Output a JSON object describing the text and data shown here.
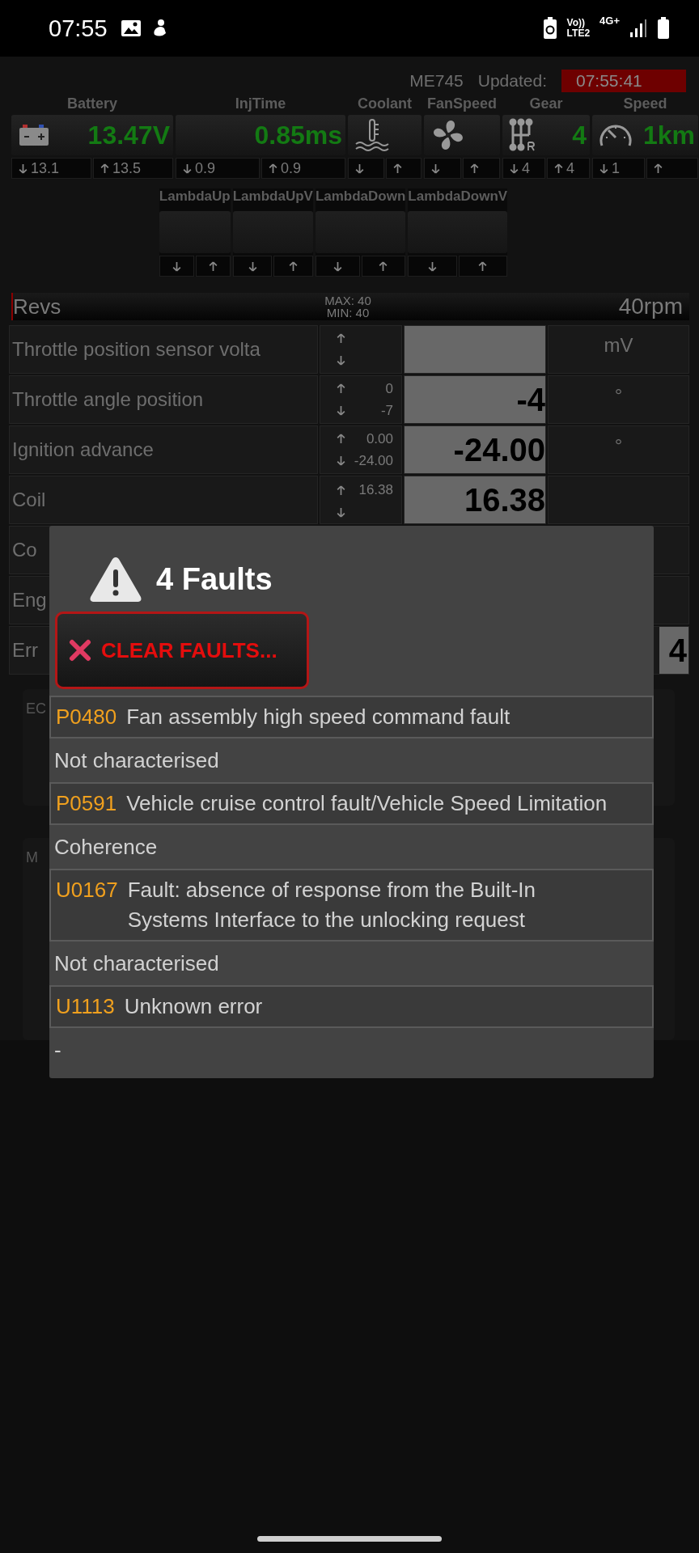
{
  "status_bar": {
    "time": "07:55",
    "volte": "Vo))",
    "lte": "LTE2",
    "network": "4G+"
  },
  "header": {
    "device": "ME745",
    "updated_label": "Updated:",
    "updated_time": "07:55:41"
  },
  "gauges": [
    {
      "label": "Battery",
      "kind": "battery",
      "value": "13.47V",
      "min": "13.1",
      "max": "13.5"
    },
    {
      "label": "InjTime",
      "kind": "none",
      "value": "0.85ms",
      "min": "0.9",
      "max": "0.9"
    },
    {
      "label": "Coolant",
      "kind": "coolant"
    },
    {
      "label": "FanSpeed",
      "kind": "fan"
    },
    {
      "label": "Gear",
      "kind": "gear",
      "value": "4",
      "min": "4",
      "max": "4"
    },
    {
      "label": "Speed",
      "kind": "speed",
      "value": "1km",
      "min": "1"
    }
  ],
  "lambda": [
    {
      "label": "LambdaUp"
    },
    {
      "label": "LambdaUpV"
    },
    {
      "label": "LambdaDown"
    },
    {
      "label": "LambdaDownV"
    }
  ],
  "revs": {
    "label": "Revs",
    "max": "MAX: 40",
    "min": "MIN: 40",
    "value": "40rpm"
  },
  "rows": [
    {
      "kind": "reading",
      "name": "Throttle position sensor volta",
      "unit": "mV"
    },
    {
      "kind": "reading",
      "name": "Throttle angle position",
      "max": "0",
      "min": "-7",
      "value": "-4",
      "unit": "°"
    },
    {
      "kind": "reading",
      "name": "Ignition advance",
      "max": "0.00",
      "min": "-24.00",
      "value": "-24.00",
      "unit": "°"
    },
    {
      "kind": "reading",
      "name": "Coil",
      "max": "16.38",
      "value": "16.38"
    },
    {
      "kind": "covered",
      "name": "Co"
    },
    {
      "kind": "covered",
      "name": "Eng"
    },
    {
      "kind": "count",
      "name": "Err",
      "value": "4"
    }
  ],
  "panels": [
    {
      "title": "EC"
    },
    {
      "title": "M"
    }
  ],
  "dialog": {
    "title": "4 Faults",
    "clear_button": "CLEAR FAULTS...",
    "faults": [
      {
        "code": "P0480",
        "description": "Fan assembly high speed command fault",
        "status": "Not characterised"
      },
      {
        "code": "P0591",
        "description": "Vehicle cruise control fault/Vehicle Speed Limitation",
        "status": "Coherence"
      },
      {
        "code": "U0167",
        "description": "Fault: absence of response from the Built-In Systems Interface to the unlocking request",
        "status": "Not characterised"
      },
      {
        "code": "U1113",
        "description": "Unknown error",
        "status": "-"
      }
    ]
  }
}
